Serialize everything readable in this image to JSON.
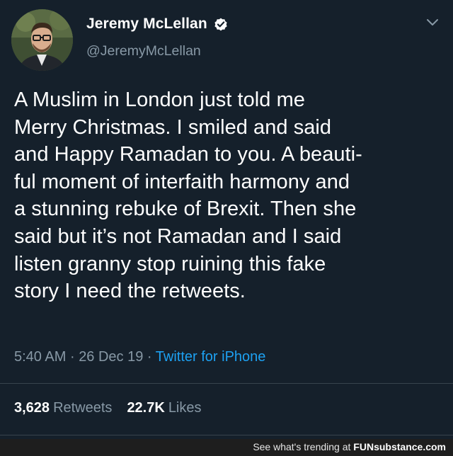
{
  "author": {
    "display_name": "Jeremy McLellan",
    "handle": "@JeremyMcLellan",
    "verified": true
  },
  "tweet": {
    "text": "A Muslim in London just told me\nMerry Christmas. I smiled and said\nand Happy Ramadan to you. A beauti-\nful moment of interfaith harmony and\na stunning rebuke of Brexit. Then she\nsaid but it’s not Ramadan and I said\nlisten granny stop ruining this fake\nstory I need the retweets.",
    "time": "5:40 AM",
    "separator": "·",
    "date": "26 Dec 19",
    "source": "Twitter for iPhone"
  },
  "stats": {
    "retweets_count": "3,628",
    "retweets_label": "Retweets",
    "likes_count": "22.7K",
    "likes_label": "Likes"
  },
  "footer": {
    "text": "See what's trending at ",
    "brand": "FUNsubstance.com"
  },
  "colors": {
    "background": "#15202b",
    "secondary_text": "#8899a6",
    "link": "#1da1f2",
    "verified": "#ffffff"
  },
  "icons": {
    "verified": "verified-badge-icon",
    "more": "chevron-down-icon"
  }
}
